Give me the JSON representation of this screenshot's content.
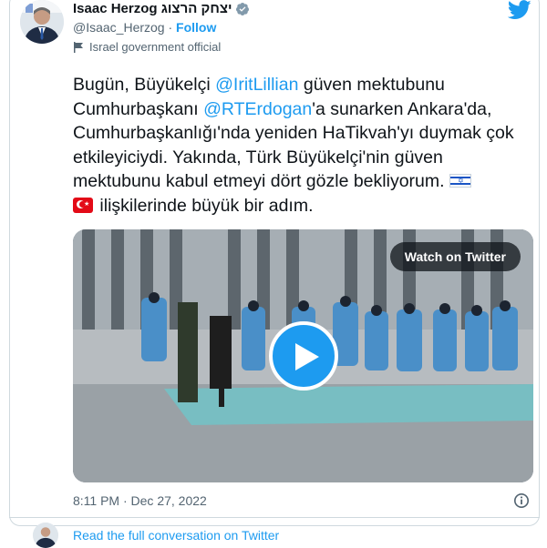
{
  "tweet": {
    "author_name": "Isaac Herzog יצחק הרצוג",
    "handle": "@Isaac_Herzog",
    "separator": " · ",
    "follow_label": "Follow",
    "account_label": "Israel government official",
    "text": {
      "part1": "Bugün, Büyükelçi ",
      "mention1": "@IritLillian",
      "part2": " güven mektubunu Cumhurbaşkanı ",
      "mention2": "@RTErdogan",
      "part3": "'a sunarken Ankara'da, Cumhurbaşkanlığı'nda yeniden HaTikvah'yı duymak çok etkileyiciydi. Yakında, Türk Büyükelçi'nin güven mektubunu kabul etmeyi dört gözle bekliyorum. ",
      "part4": " ilişkilerinde büyük bir adım."
    },
    "video": {
      "watch_label": "Watch on Twitter"
    },
    "timestamp": "8:11 PM · Dec 27, 2022",
    "footer_link": "Read the full conversation on Twitter"
  },
  "icons": [
    "verified-badge-icon",
    "twitter-bird-icon",
    "flag-icon",
    "israel-flag-emoji",
    "turkey-flag-emoji",
    "play-icon",
    "info-icon"
  ],
  "colors": {
    "link": "#1d9bf0",
    "secondary_text": "#536471",
    "text": "#0f1419",
    "border": "#cfd9de"
  }
}
